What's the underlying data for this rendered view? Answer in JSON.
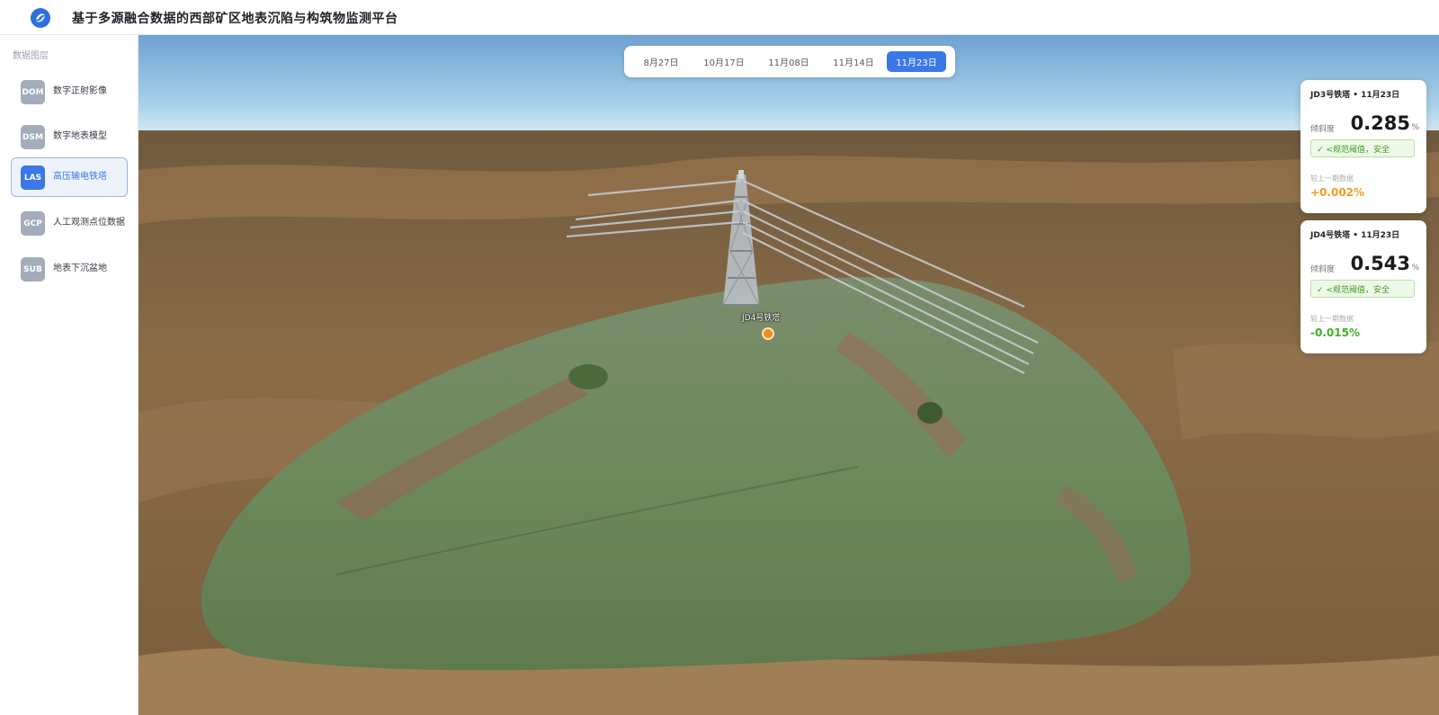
{
  "app": {
    "title": "基于多源融合数据的西部矿区地表沉陷与构筑物监测平台",
    "logo_icon": "logo-icon"
  },
  "sidebar": {
    "heading": "数据图层",
    "active_index": 2,
    "items": [
      {
        "badge": "DOM",
        "label": "数字正射影像"
      },
      {
        "badge": "DSM",
        "label": "数字地表模型"
      },
      {
        "badge": "LAS",
        "label": "高压输电铁塔"
      },
      {
        "badge": "GCP",
        "label": "人工观测点位数据"
      },
      {
        "badge": "SUB",
        "label": "地表下沉盆地"
      }
    ]
  },
  "dates": {
    "active_index": 4,
    "tabs": [
      "8月27日",
      "10月17日",
      "11月08日",
      "11月14日",
      "11月23日"
    ]
  },
  "map": {
    "tower_label": "JD4号铁塔",
    "marker_color": "#f08a24"
  },
  "cards": [
    {
      "title": "JD3号铁塔 • 11月23日",
      "metric_label": "倾斜度",
      "value": "0.285",
      "unit": "%",
      "status": "✓ <规范阈值，安全",
      "compare_label": "较上一期数据",
      "delta": "+0.002%",
      "delta_color": "#f09a1c"
    },
    {
      "title": "JD4号铁塔 • 11月23日",
      "metric_label": "倾斜度",
      "value": "0.543",
      "unit": "%",
      "status": "✓ <规范阈值，安全",
      "compare_label": "较上一期数据",
      "delta": "-0.015%",
      "delta_color": "#3fae2a"
    }
  ],
  "colors": {
    "accent": "#3b78e7",
    "safe_green": "#3b9b22"
  }
}
